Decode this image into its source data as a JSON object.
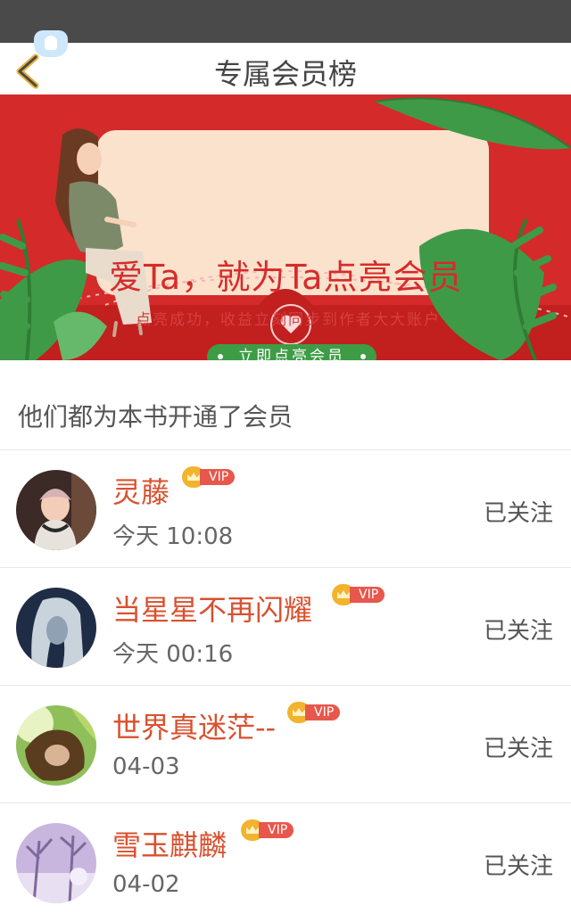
{
  "nav": {
    "title": "专属会员榜",
    "back_icon": "chevron-left-icon",
    "notif_icon": "bell-icon"
  },
  "banner": {
    "title": "爱Ta，就为Ta点亮会员",
    "subtitle": "点亮成功，收益立刻同步到作者大大账户",
    "button_label": "立即点亮会员",
    "colors": {
      "background": "#d42a2a",
      "card": "#fbe2cc",
      "button": "#3e9c46",
      "leaf": "#3f9a48"
    }
  },
  "list": {
    "heading": "他们都为本书开通了会员",
    "vip_label": "VIP",
    "members": [
      {
        "name": "灵藤",
        "time": "今天 10:08",
        "follow_label": "已关注"
      },
      {
        "name": "当星星不再闪耀",
        "time": "今天 00:16",
        "follow_label": "已关注"
      },
      {
        "name": "世界真迷茫--",
        "time": "04-03",
        "follow_label": "已关注"
      },
      {
        "name": "雪玉麒麟",
        "time": "04-02",
        "follow_label": "已关注"
      }
    ]
  }
}
